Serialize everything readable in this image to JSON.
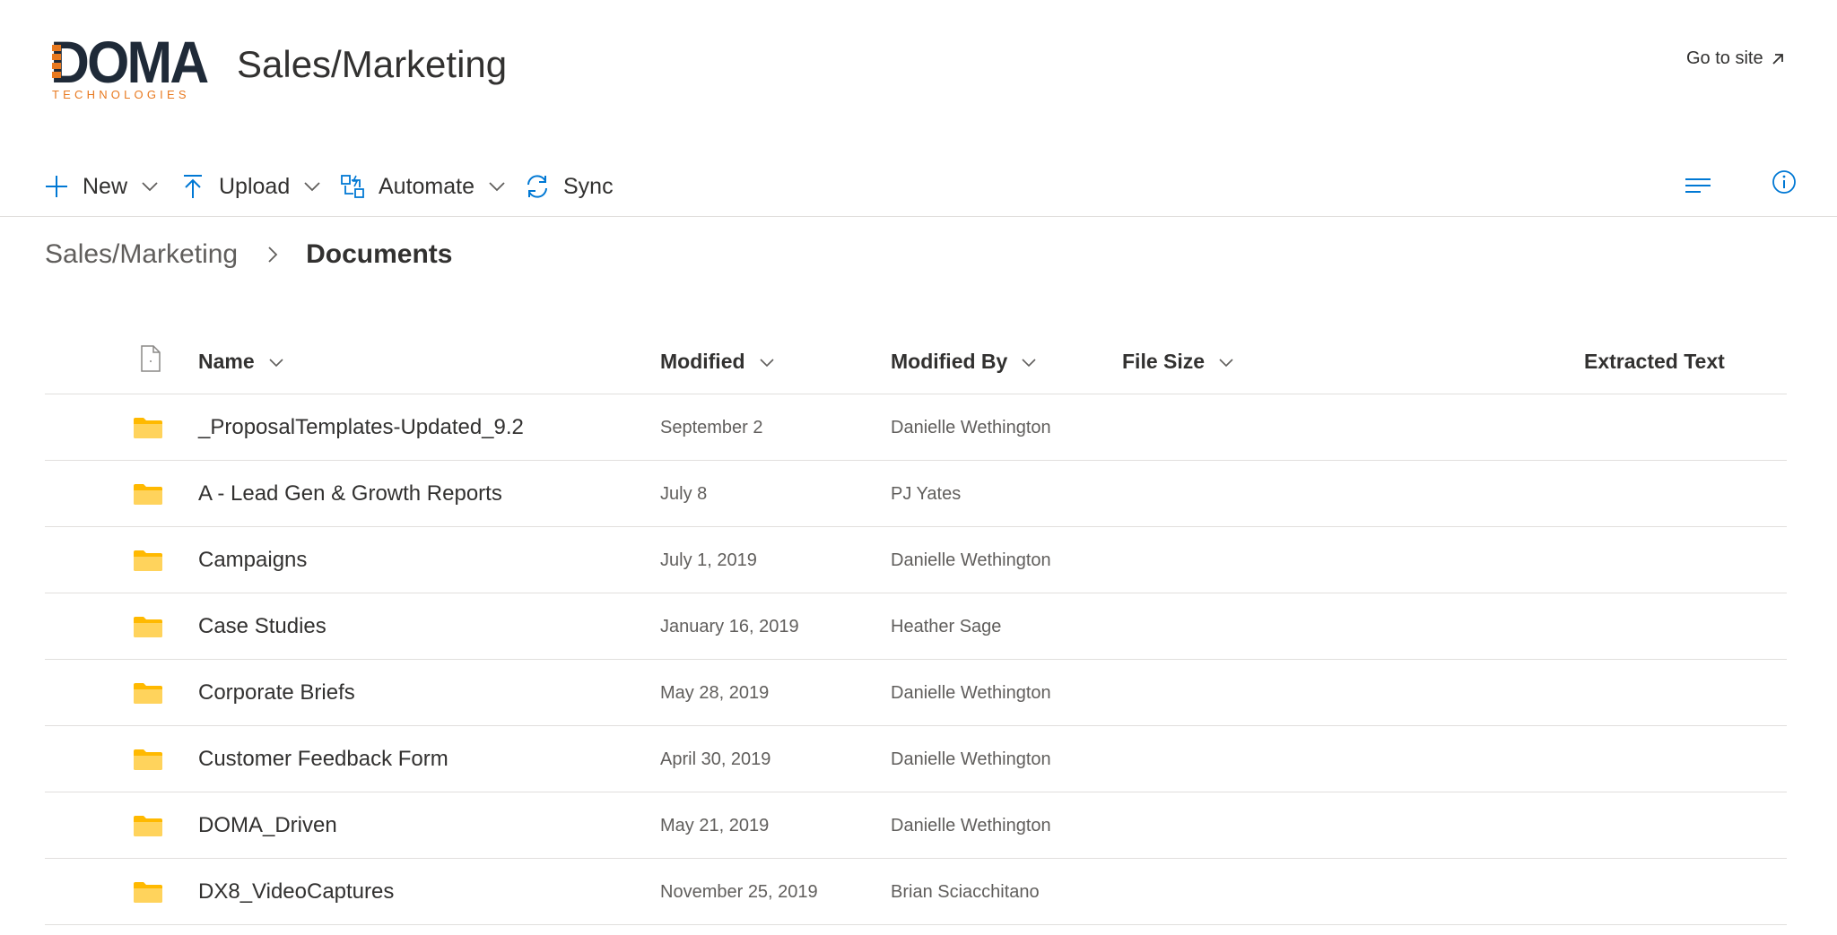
{
  "header": {
    "logo_word": "DOMA",
    "logo_tagline": "TECHNOLOGIES",
    "site_title": "Sales/Marketing",
    "go_to_site": "Go to site"
  },
  "commands": {
    "new": "New",
    "upload": "Upload",
    "automate": "Automate",
    "sync": "Sync"
  },
  "breadcrumb": {
    "parent": "Sales/Marketing",
    "current": "Documents"
  },
  "columns": {
    "name": "Name",
    "modified": "Modified",
    "modified_by": "Modified By",
    "file_size": "File Size",
    "extracted_text": "Extracted Text"
  },
  "rows": [
    {
      "name": "_ProposalTemplates-Updated_9.2",
      "modified": "September 2",
      "modified_by": "Danielle Wethington"
    },
    {
      "name": "A - Lead Gen & Growth Reports",
      "modified": "July 8",
      "modified_by": "PJ Yates"
    },
    {
      "name": "Campaigns",
      "modified": "July 1, 2019",
      "modified_by": "Danielle Wethington"
    },
    {
      "name": "Case Studies",
      "modified": "January 16, 2019",
      "modified_by": "Heather Sage"
    },
    {
      "name": "Corporate Briefs",
      "modified": "May 28, 2019",
      "modified_by": "Danielle Wethington"
    },
    {
      "name": "Customer Feedback Form",
      "modified": "April 30, 2019",
      "modified_by": "Danielle Wethington"
    },
    {
      "name": "DOMA_Driven",
      "modified": "May 21, 2019",
      "modified_by": "Danielle Wethington"
    },
    {
      "name": "DX8_VideoCaptures",
      "modified": "November 25, 2019",
      "modified_by": "Brian Sciacchitano"
    }
  ],
  "icons": {
    "brand_orange": "#e8791f",
    "brand_navy": "#1f2a38",
    "accent_blue": "#0078d4",
    "folder_color": "#ffd35c"
  }
}
